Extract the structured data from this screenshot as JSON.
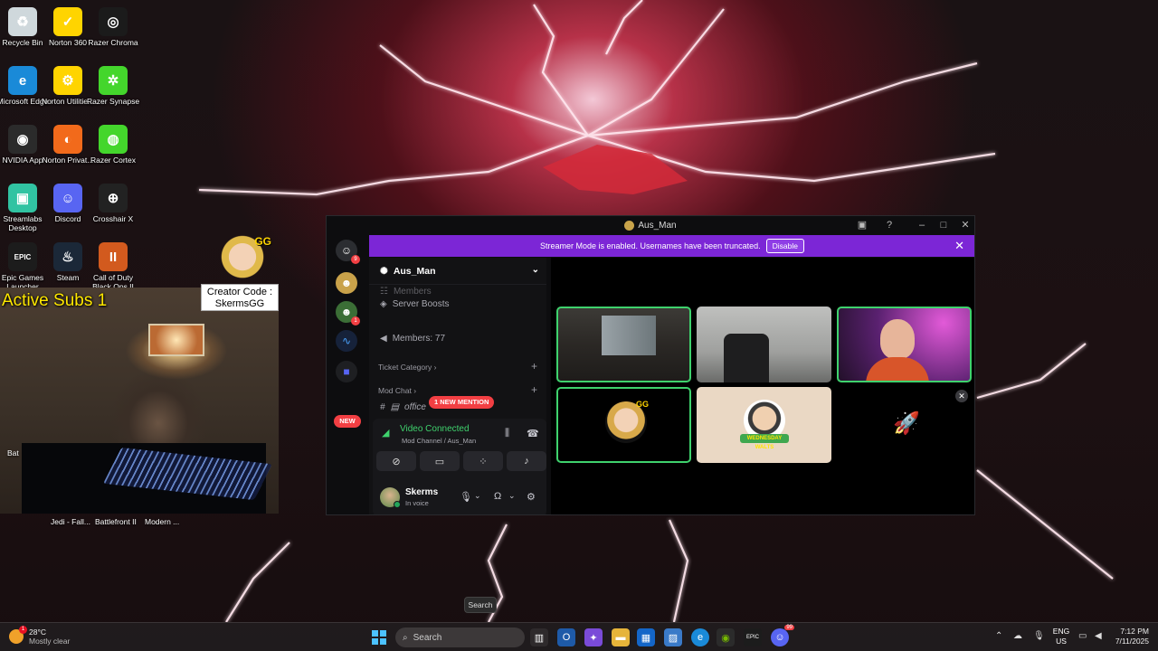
{
  "desktop": {
    "icons": [
      {
        "label": "Recycle Bin",
        "icon": "recycle-bin-icon",
        "color": "#cfd8dc",
        "glyph": "♻"
      },
      {
        "label": "Norton 360",
        "icon": "norton-360-icon",
        "color": "#ffd400",
        "glyph": "✓"
      },
      {
        "label": "Razer Chroma",
        "icon": "razer-chroma-icon",
        "color": "#1b1b1b",
        "glyph": "◎"
      },
      {
        "label": "Microsoft Edge",
        "icon": "edge-icon",
        "color": "#1a8ad8",
        "glyph": "e"
      },
      {
        "label": "Norton Utilitie...",
        "icon": "norton-utilities-icon",
        "color": "#ffd400",
        "glyph": "⚙"
      },
      {
        "label": "Razer Synapse",
        "icon": "razer-synapse-icon",
        "color": "#44d62c",
        "glyph": "✲"
      },
      {
        "label": "NVIDIA App",
        "icon": "nvidia-icon",
        "color": "#2b2b2b",
        "glyph": "◉"
      },
      {
        "label": "Norton Privat...",
        "icon": "norton-private-browser-icon",
        "color": "#f26a1b",
        "glyph": "◐"
      },
      {
        "label": "Razer Cortex",
        "icon": "razer-cortex-icon",
        "color": "#44d62c",
        "glyph": "◍"
      },
      {
        "label": "Streamlabs Desktop",
        "icon": "streamlabs-icon",
        "color": "#31c3a2",
        "glyph": "▣"
      },
      {
        "label": "Discord",
        "icon": "discord-icon",
        "color": "#5865f2",
        "glyph": "☺"
      },
      {
        "label": "Crosshair X",
        "icon": "crosshair-x-icon",
        "color": "#222222",
        "glyph": "⊕"
      },
      {
        "label": "Epic Games Launcher",
        "icon": "epic-games-icon",
        "color": "#1c1c1c",
        "glyph": "EPIC"
      },
      {
        "label": "Steam",
        "icon": "steam-icon",
        "color": "#1b2838",
        "glyph": "♨"
      },
      {
        "label": "Call of Duty Black Ops II",
        "icon": "call-of-duty-icon",
        "color": "#d25a1e",
        "glyph": "II"
      }
    ],
    "partial_labels": {
      "bat": "Bat",
      "jedi": "Jedi - Fall...",
      "battlefront": "Battlefront II",
      "cod_modern": "Modern ..."
    }
  },
  "overlay": {
    "active_subs": "Active Subs 1",
    "creator_code_line1": "Creator Code :",
    "creator_code_line2": "SkermsGG",
    "mascot_badge": "GG"
  },
  "discord": {
    "window_title": "Aus_Man",
    "streamer_banner": "Streamer Mode is enabled. Usernames have been truncated.",
    "disable_label": "Disable",
    "server_name": "Aus_Man",
    "channels": {
      "members_cut": "Members",
      "server_boosts": "Server Boosts",
      "members": "Members: 77",
      "ticket_category": "Ticket Category",
      "mod_chat": "Mod Chat",
      "office": "office"
    },
    "new_label": "NEW",
    "new_mention": "1 NEW MENTION",
    "voice": {
      "status": "Video Connected",
      "channel": "Mod Channel / Aus_Man"
    },
    "user": {
      "name": "Skerms",
      "status": "In voice"
    },
    "guild_badges": {
      "home": "9",
      "server2": "1"
    },
    "tiles": {
      "gg_badge": "GG",
      "ribbon": "WEDNESDAY WALTS"
    }
  },
  "tooltip": {
    "search": "Search"
  },
  "taskbar": {
    "weather_temp": "28°C",
    "weather_desc": "Mostly clear",
    "weather_badge": "1",
    "search_placeholder": "Search",
    "lang_line1": "ENG",
    "lang_line2": "US",
    "time": "7:12 PM",
    "date": "7/11/2025",
    "discord_badge": "99"
  },
  "colors": {
    "accent": "#7c26d6",
    "connected": "#3fd26d",
    "alert": "#f23f43"
  }
}
